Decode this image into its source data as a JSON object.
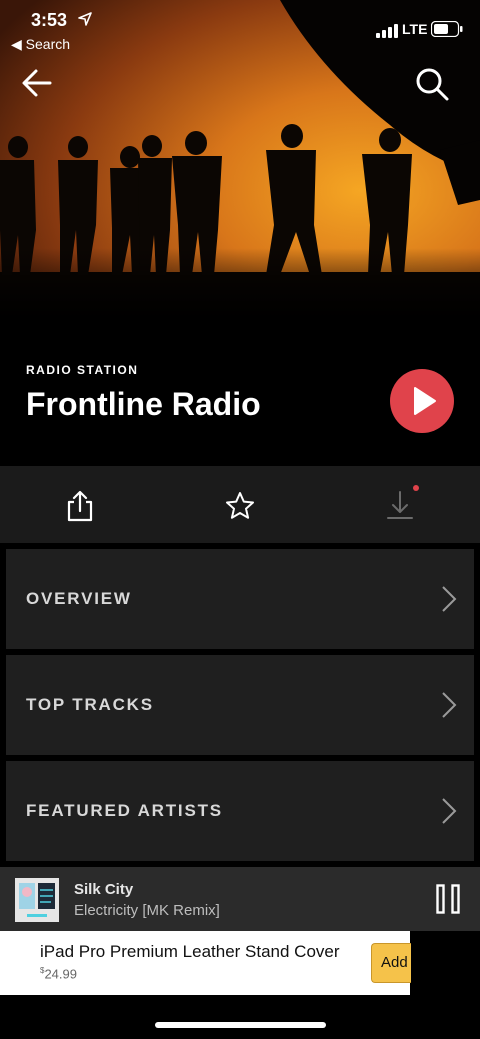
{
  "status_bar": {
    "time": "3:53",
    "back_app": "◀ Search",
    "network": "LTE"
  },
  "header": {
    "kicker": "RADIO STATION",
    "title": "Frontline Radio"
  },
  "menu": {
    "items": [
      {
        "label": "OVERVIEW"
      },
      {
        "label": "TOP TRACKS"
      },
      {
        "label": "FEATURED ARTISTS"
      }
    ]
  },
  "now_playing": {
    "title": "Silk City",
    "subtitle": "Electricity [MK Remix]"
  },
  "ad": {
    "title": "iPad Pro Premium Leather Stand Cover",
    "price_currency": "$",
    "price": "24.99",
    "button": "Add"
  },
  "colors": {
    "accent": "#e0434b",
    "ad_button": "#f5c24a"
  },
  "icons": [
    "location-arrow-icon",
    "signal-icon",
    "battery-icon",
    "back-arrow-icon",
    "search-icon",
    "play-icon",
    "share-icon",
    "star-icon",
    "download-icon",
    "chevron-right-icon",
    "pause-icon"
  ]
}
